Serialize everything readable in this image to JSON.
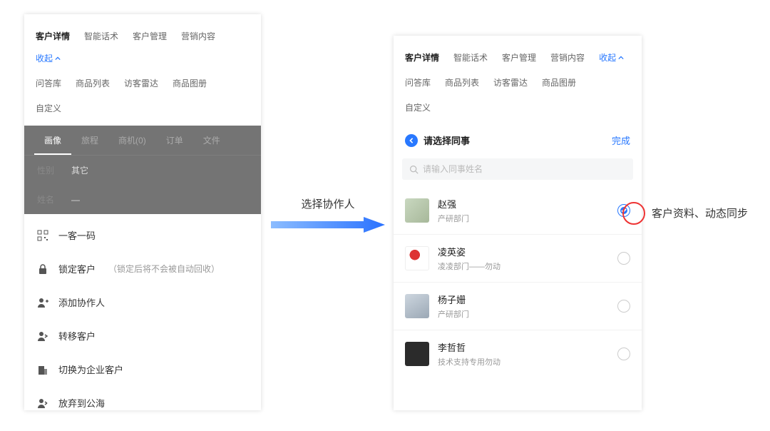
{
  "nav": {
    "tabs": [
      "客户详情",
      "智能话术",
      "客户管理",
      "营销内容"
    ],
    "collapse": "收起",
    "row2": [
      "问答库",
      "商品列表",
      "访客雷达",
      "商品图册"
    ],
    "row3": [
      "自定义"
    ]
  },
  "left": {
    "subtabs": [
      "画像",
      "旅程",
      "商机(0)",
      "订单",
      "文件"
    ],
    "rows": [
      {
        "k": "性别",
        "v": "其它"
      },
      {
        "k": "姓名",
        "v": "—"
      }
    ],
    "actions": [
      {
        "icon": "qr",
        "label": "一客一码",
        "hint": ""
      },
      {
        "icon": "lock",
        "label": "锁定客户",
        "hint": "（锁定后将不会被自动回收）"
      },
      {
        "icon": "user-add",
        "label": "添加协作人",
        "hint": ""
      },
      {
        "icon": "transfer",
        "label": "转移客户",
        "hint": ""
      },
      {
        "icon": "company",
        "label": "切换为企业客户",
        "hint": ""
      },
      {
        "icon": "sea",
        "label": "放弃到公海",
        "hint": ""
      }
    ]
  },
  "arrow": {
    "label": "选择协作人"
  },
  "right": {
    "title": "请选择同事",
    "done": "完成",
    "search_placeholder": "请输入同事姓名",
    "people": [
      {
        "name": "赵强",
        "dept": "产研部门",
        "checked": true
      },
      {
        "name": "凌英姿",
        "dept": "凌凌部门——勿动",
        "checked": false
      },
      {
        "name": "杨子姗",
        "dept": "产研部门",
        "checked": false
      },
      {
        "name": "李哲哲",
        "dept": "技术支持专用勿动",
        "checked": false
      }
    ]
  },
  "callout": "客户资料、动态同步"
}
